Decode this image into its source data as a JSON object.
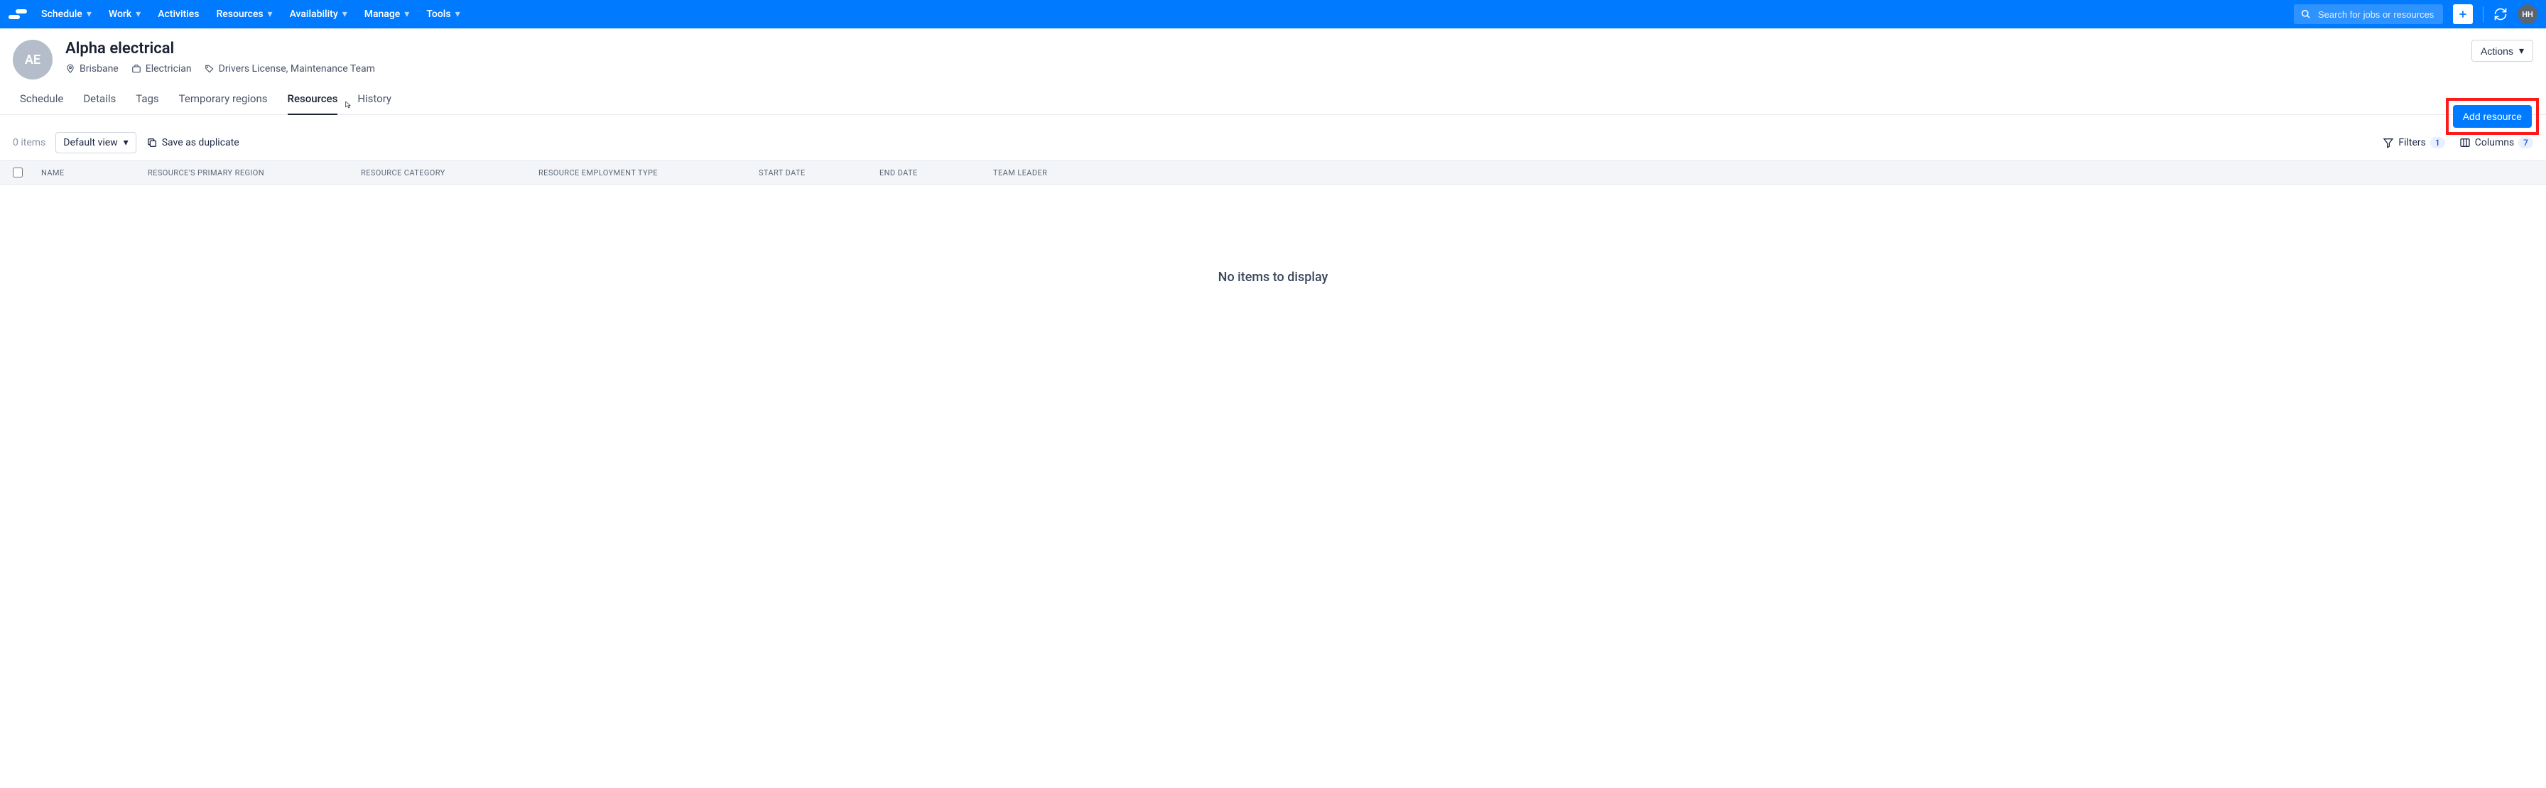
{
  "nav": {
    "items": [
      "Schedule",
      "Work",
      "Activities",
      "Resources",
      "Availability",
      "Manage",
      "Tools"
    ],
    "items_dropdown": [
      true,
      true,
      false,
      true,
      true,
      true,
      true
    ],
    "search_placeholder": "Search for jobs or resources",
    "user_initials": "HH"
  },
  "header": {
    "avatar_initials": "AE",
    "title": "Alpha electrical",
    "location": "Brisbane",
    "role": "Electrician",
    "tags": "Drivers License, Maintenance Team",
    "actions_label": "Actions"
  },
  "tabs": [
    "Schedule",
    "Details",
    "Tags",
    "Temporary regions",
    "Resources",
    "History"
  ],
  "active_tab_index": 4,
  "primary_action_label": "Add resource",
  "toolbar": {
    "count_text": "0 items",
    "view_label": "Default view",
    "duplicate_label": "Save as duplicate",
    "filters_label": "Filters",
    "filters_count": "1",
    "columns_label": "Columns",
    "columns_count": "7"
  },
  "columns": [
    "NAME",
    "RESOURCE'S PRIMARY REGION",
    "RESOURCE CATEGORY",
    "RESOURCE EMPLOYMENT TYPE",
    "START DATE",
    "END DATE",
    "TEAM LEADER"
  ],
  "empty_message": "No items to display"
}
